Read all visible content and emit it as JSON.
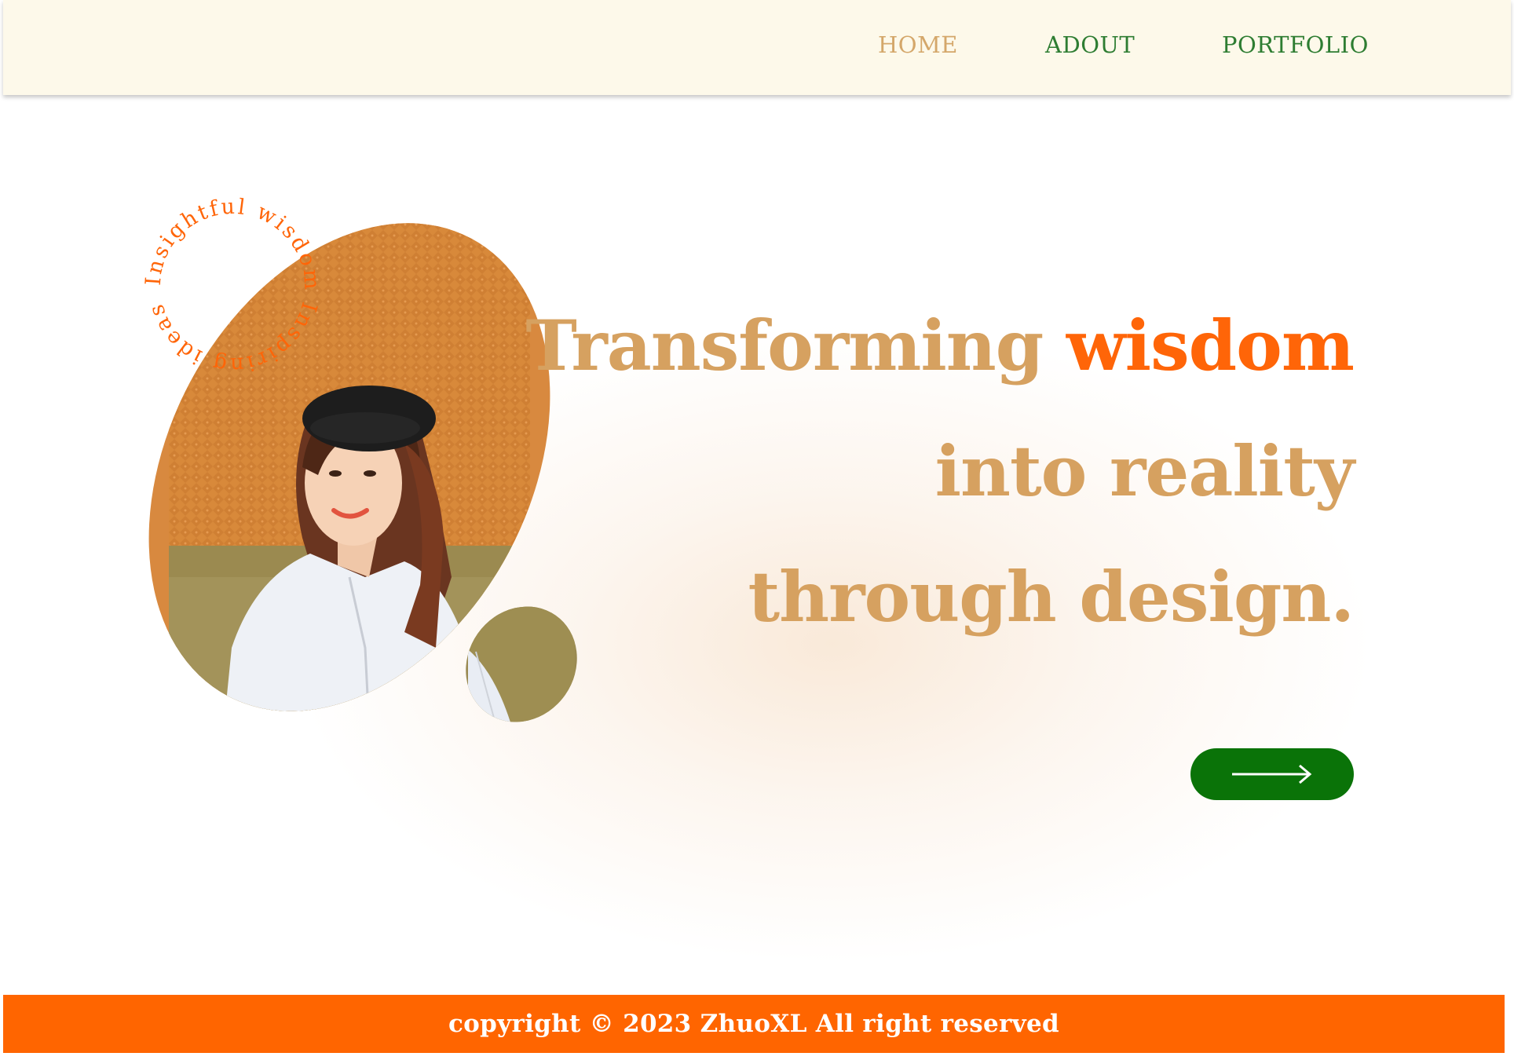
{
  "nav": {
    "items": [
      {
        "label": "HOME",
        "active": true
      },
      {
        "label": "ADOUT",
        "active": false
      },
      {
        "label": "PORTFOLIO",
        "active": false
      }
    ]
  },
  "badge": {
    "circle_text": "Insightful wisdom Inspiring ideas"
  },
  "hero": {
    "line1_main": "Transforming",
    "line1_accent": "wisdom",
    "line2": "into reality",
    "line3": "through design."
  },
  "cta": {
    "icon": "arrow-right-icon"
  },
  "footer": {
    "text": "copyright © 2023 ZhuoXL All right reserved"
  },
  "colors": {
    "accent_orange": "#ff6508",
    "heading_tan": "#d6a160",
    "nav_green": "#2e7d32",
    "button_green": "#0a7308",
    "header_bg": "#fdf9ea"
  }
}
